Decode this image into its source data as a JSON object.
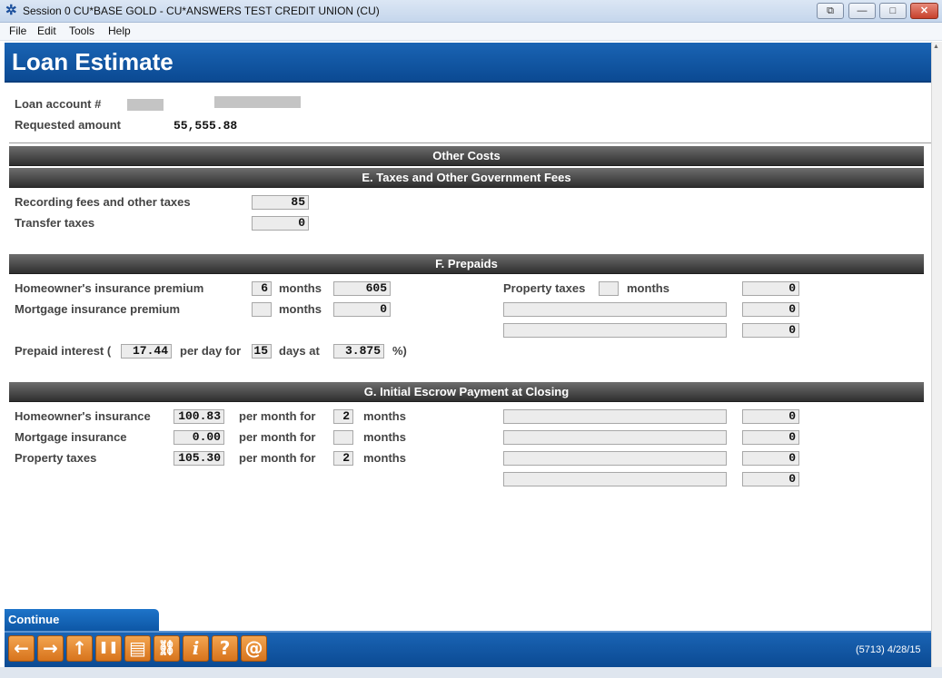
{
  "window": {
    "title": "Session 0 CU*BASE GOLD - CU*ANSWERS TEST CREDIT UNION (CU)",
    "buttons": [
      "⧉",
      "—",
      "□",
      "✕"
    ]
  },
  "menu": [
    "File",
    "Edit",
    "Tools",
    "Help"
  ],
  "page": {
    "title": "Loan Estimate",
    "loan_account_label": "Loan account #",
    "requested_amount_label": "Requested amount",
    "requested_amount_value": "55,555.88"
  },
  "sections": {
    "other_costs": "Other Costs",
    "taxes": "E. Taxes and Other Government Fees",
    "prepaids": "F. Prepaids",
    "escrow": "G. Initial Escrow Payment at Closing"
  },
  "taxes": {
    "recording_label": "Recording fees and other taxes",
    "recording_value": "85",
    "transfer_label": "Transfer taxes",
    "transfer_value": "0"
  },
  "prepaids": {
    "homeowners_label": "Homeowner's insurance premium",
    "homeowners_months": "6",
    "homeowners_amount": "605",
    "mortgage_label": "Mortgage insurance premium",
    "mortgage_months": "",
    "mortgage_amount": "0",
    "months_label": "months",
    "property_taxes_label": "Property taxes",
    "property_taxes_months": "",
    "property_taxes_amount": "0",
    "other_1_desc": "",
    "other_1_amount": "0",
    "other_2_desc": "",
    "other_2_amount": "0",
    "interest_label_1": "Prepaid interest (",
    "interest_per_day": "17.44",
    "interest_label_2": "per day for",
    "interest_days": "15",
    "interest_label_3": "days at",
    "interest_rate": "3.875",
    "interest_label_4": "%)"
  },
  "escrow": {
    "per_month_for": "per month for",
    "months": "months",
    "rows": [
      {
        "label": "Homeowner's insurance",
        "amount": "100.83",
        "months": "2"
      },
      {
        "label": "Mortgage insurance",
        "amount": "0.00",
        "months": ""
      },
      {
        "label": "Property taxes",
        "amount": "105.30",
        "months": "2"
      }
    ],
    "other_rows": [
      {
        "desc": "",
        "amount": "0"
      },
      {
        "desc": "",
        "amount": "0"
      },
      {
        "desc": "",
        "amount": "0"
      },
      {
        "desc": "",
        "amount": "0"
      }
    ]
  },
  "footer": {
    "continue_label": "Continue",
    "status": "(5713) 4/28/15",
    "tools": [
      {
        "name": "back-arrow-icon",
        "glyph": "←"
      },
      {
        "name": "forward-arrow-icon",
        "glyph": "→"
      },
      {
        "name": "up-arrow-icon",
        "glyph": "↑"
      },
      {
        "name": "pause-icon",
        "glyph": "❚❚"
      },
      {
        "name": "printer-icon",
        "glyph": "▤"
      },
      {
        "name": "link-icon",
        "glyph": "⛓"
      },
      {
        "name": "info-icon",
        "glyph": "i"
      },
      {
        "name": "help-icon",
        "glyph": "?"
      },
      {
        "name": "at-sign-icon",
        "glyph": "@"
      }
    ]
  }
}
